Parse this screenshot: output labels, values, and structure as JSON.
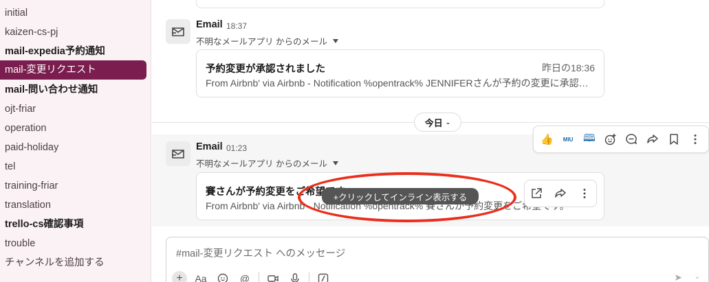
{
  "sidebar": {
    "items": [
      {
        "label": "initial",
        "style": "normal"
      },
      {
        "label": "kaizen-cs-pj",
        "style": "normal"
      },
      {
        "label": "mail-expedia予約通知",
        "style": "bold"
      },
      {
        "label": "mail-変更リクエスト",
        "style": "active"
      },
      {
        "label": "mail-問い合わせ通知",
        "style": "bold"
      },
      {
        "label": "ojt-friar",
        "style": "normal"
      },
      {
        "label": "operation",
        "style": "normal"
      },
      {
        "label": "paid-holiday",
        "style": "normal"
      },
      {
        "label": "tel",
        "style": "normal"
      },
      {
        "label": "training-friar",
        "style": "normal"
      },
      {
        "label": "translation",
        "style": "normal"
      },
      {
        "label": "trello-cs確認事項",
        "style": "bold"
      },
      {
        "label": "trouble",
        "style": "normal"
      },
      {
        "label": "チャンネルを追加する",
        "style": "normal"
      }
    ]
  },
  "messages": [
    {
      "sender": "Email",
      "time": "18:37",
      "source": "不明なメールアプリ からのメール",
      "email": {
        "subject": "予約変更が承認されました",
        "date": "昨日の18:36",
        "preview": "From Airbnb' via Airbnb - Notification  %opentrack% JENNIFERさんが予約の変更に承認しました。"
      }
    },
    {
      "sender": "Email",
      "time": "01:23",
      "source": "不明なメールアプリ からのメール",
      "email": {
        "subject": "賽さんが予約変更をご希望です",
        "date": "",
        "preview": "From Airbnb' via Airbnb - Notification  %opentrack% 賽さんが予約変更をご希望です。"
      }
    }
  ],
  "divider": {
    "label": "今日"
  },
  "toolbar": {
    "reactions": [
      "👍",
      "MIU",
      "🕮"
    ],
    "icons": [
      "add-reaction-icon",
      "reply-thread-icon",
      "share-icon",
      "bookmark-icon",
      "more-icon"
    ]
  },
  "card_actions": {
    "icons": [
      "open-external-icon",
      "share-icon",
      "more-icon"
    ]
  },
  "tooltip": {
    "text": "+クリックしてインライン表示する"
  },
  "annotation": {
    "color": "#ea2e1c"
  },
  "composer": {
    "placeholder": "#mail-変更リクエスト へのメッセージ",
    "format_label": "Aa"
  },
  "colors": {
    "active_channel": "#7b1d4e",
    "sidebar_bg": "#faf2f4"
  }
}
